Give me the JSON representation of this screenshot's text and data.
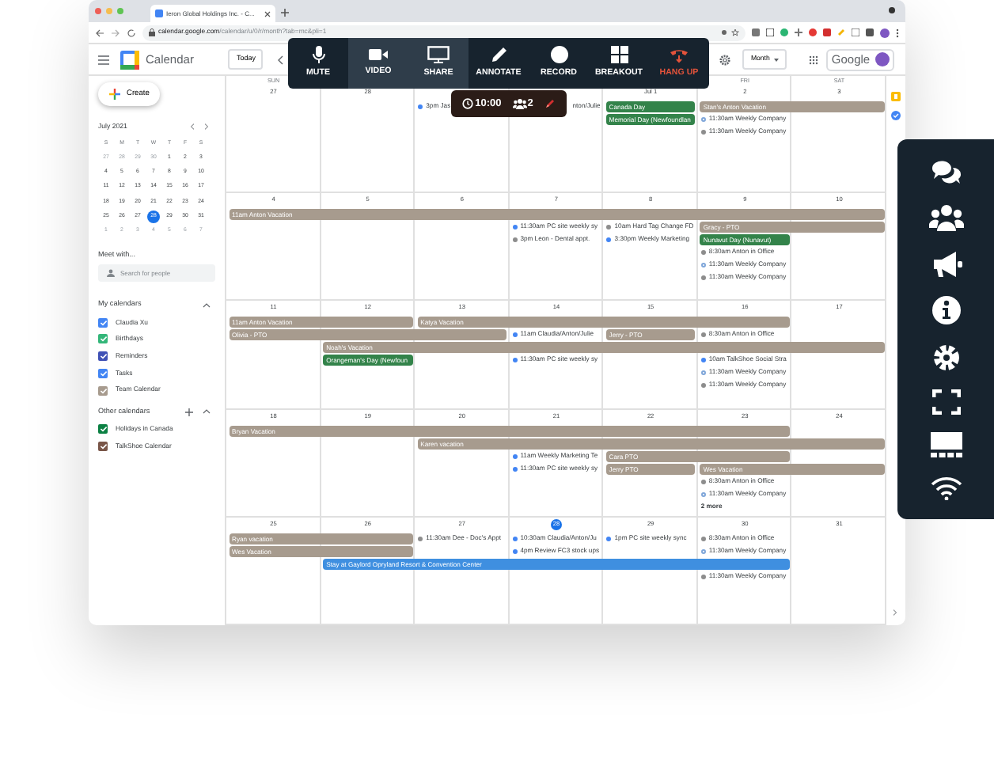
{
  "browser": {
    "tab_title": "Ieron Global Holdings Inc. - C...",
    "url_host": "calendar.google.com",
    "url_path": "/calendar/u/0/r/month?tab=mc&pli=1"
  },
  "app_header": {
    "title": "Calendar",
    "today": "Today",
    "view": "Month",
    "brand": "Google"
  },
  "call_toolbar": {
    "buttons": [
      {
        "label": "MUTE",
        "selected": false,
        "kind": "normal"
      },
      {
        "label": "VIDEO",
        "selected": true,
        "kind": "normal"
      },
      {
        "label": "SHARE",
        "selected": true,
        "kind": "normal"
      },
      {
        "label": "ANNOTATE",
        "selected": false,
        "kind": "normal"
      },
      {
        "label": "RECORD",
        "selected": false,
        "kind": "normal"
      },
      {
        "label": "BREAKOUT",
        "selected": false,
        "kind": "normal"
      },
      {
        "label": "HANG UP",
        "selected": false,
        "kind": "danger"
      }
    ],
    "timer": "10:00",
    "participants": "2"
  },
  "sidebar": {
    "create": "Create",
    "mini_calendar": {
      "month": "July 2021",
      "weekdays": [
        "S",
        "M",
        "T",
        "W",
        "T",
        "F",
        "S"
      ],
      "weeks": [
        [
          {
            "label": "27",
            "outside": true,
            "selected": false
          },
          {
            "label": "28",
            "outside": true,
            "selected": false
          },
          {
            "label": "29",
            "outside": true,
            "selected": false
          },
          {
            "label": "30",
            "outside": true,
            "selected": false
          },
          {
            "label": "1",
            "outside": false,
            "selected": false
          },
          {
            "label": "2",
            "outside": false,
            "selected": false
          },
          {
            "label": "3",
            "outside": false,
            "selected": false
          }
        ],
        [
          {
            "label": "4",
            "outside": false,
            "selected": false
          },
          {
            "label": "5",
            "outside": false,
            "selected": false
          },
          {
            "label": "6",
            "outside": false,
            "selected": false
          },
          {
            "label": "7",
            "outside": false,
            "selected": false
          },
          {
            "label": "8",
            "outside": false,
            "selected": false
          },
          {
            "label": "9",
            "outside": false,
            "selected": false
          },
          {
            "label": "10",
            "outside": false,
            "selected": false
          }
        ],
        [
          {
            "label": "11",
            "outside": false,
            "selected": false
          },
          {
            "label": "12",
            "outside": false,
            "selected": false
          },
          {
            "label": "13",
            "outside": false,
            "selected": false
          },
          {
            "label": "14",
            "outside": false,
            "selected": false
          },
          {
            "label": "15",
            "outside": false,
            "selected": false
          },
          {
            "label": "16",
            "outside": false,
            "selected": false
          },
          {
            "label": "17",
            "outside": false,
            "selected": false
          }
        ],
        [
          {
            "label": "18",
            "outside": false,
            "selected": false
          },
          {
            "label": "19",
            "outside": false,
            "selected": false
          },
          {
            "label": "20",
            "outside": false,
            "selected": false
          },
          {
            "label": "21",
            "outside": false,
            "selected": false
          },
          {
            "label": "22",
            "outside": false,
            "selected": false
          },
          {
            "label": "23",
            "outside": false,
            "selected": false
          },
          {
            "label": "24",
            "outside": false,
            "selected": false
          }
        ],
        [
          {
            "label": "25",
            "outside": false,
            "selected": false
          },
          {
            "label": "26",
            "outside": false,
            "selected": false
          },
          {
            "label": "27",
            "outside": false,
            "selected": false
          },
          {
            "label": "28",
            "outside": false,
            "selected": true
          },
          {
            "label": "29",
            "outside": false,
            "selected": false
          },
          {
            "label": "30",
            "outside": false,
            "selected": false
          },
          {
            "label": "31",
            "outside": false,
            "selected": false
          }
        ],
        [
          {
            "label": "1",
            "outside": true,
            "selected": false
          },
          {
            "label": "2",
            "outside": true,
            "selected": false
          },
          {
            "label": "3",
            "outside": true,
            "selected": false
          },
          {
            "label": "4",
            "outside": true,
            "selected": false
          },
          {
            "label": "5",
            "outside": true,
            "selected": false
          },
          {
            "label": "6",
            "outside": true,
            "selected": false
          },
          {
            "label": "7",
            "outside": true,
            "selected": false
          }
        ]
      ]
    },
    "meet_with": "Meet with...",
    "search": {
      "placeholder": "Search for people"
    },
    "my_calendars": {
      "title": "My calendars",
      "expanded": true,
      "items": [
        {
          "label": "Claudia Xu",
          "color": "#4285f4",
          "checked": true
        },
        {
          "label": "Birthdays",
          "color": "#33b679",
          "checked": true
        },
        {
          "label": "Reminders",
          "color": "#3f51b5",
          "checked": true
        },
        {
          "label": "Tasks",
          "color": "#4285f4",
          "checked": true
        },
        {
          "label": "Team Calendar",
          "color": "#a79b8e",
          "checked": true
        }
      ]
    },
    "other_calendars": {
      "title": "Other calendars",
      "expanded": true,
      "items": [
        {
          "label": "Holidays in Canada",
          "color": "#0b8043",
          "checked": true
        },
        {
          "label": "TalkShoe Calendar",
          "color": "#795548",
          "checked": true
        }
      ]
    }
  },
  "month_grid": {
    "weeks": [
      {
        "days": [
          {
            "weekday": "SUN",
            "date": "27",
            "today": false
          },
          {
            "date": "28",
            "today": false
          },
          {
            "date": "Jul 1",
            "today": false
          },
          {
            "weekday": "FRI",
            "date": "2",
            "today": false
          },
          {
            "weekday": "SAT",
            "date": "3",
            "today": false
          }
        ],
        "events": [
          {
            "kind": "timed",
            "text": "3pm Jas",
            "color": "#4285f4"
          },
          {
            "kind": "partial",
            "text": "nton/Julie"
          },
          {
            "kind": "bar",
            "text": "Canada Day",
            "color": "#33834a"
          },
          {
            "kind": "bar",
            "text": "Stan's Anton Vacation",
            "color": "#a79b8e"
          },
          {
            "kind": "bar",
            "text": "Memorial Day (Newfoundlan",
            "color": "#33834a"
          },
          {
            "kind": "tentative",
            "text": "11:30am Weekly Company",
            "color": "#7fa6d9"
          },
          {
            "kind": "timed",
            "text": "11:30am Weekly Company",
            "color": "#8d8d8d"
          }
        ]
      },
      {
        "days": [
          {
            "date": "4",
            "today": false
          },
          {
            "date": "5",
            "today": false
          },
          {
            "date": "6",
            "today": false
          },
          {
            "date": "7",
            "today": false
          },
          {
            "date": "8",
            "today": false
          },
          {
            "date": "9",
            "today": false
          },
          {
            "date": "10",
            "today": false
          }
        ],
        "events": [
          {
            "kind": "bar",
            "text": "11am Anton Vacation",
            "color": "#a79b8e"
          },
          {
            "kind": "timed",
            "text": "11:30am PC site weekly sy",
            "color": "#4285f4"
          },
          {
            "kind": "timed",
            "text": "10am Hard Tag Change FD",
            "color": "#8d8d8d"
          },
          {
            "kind": "bar",
            "text": "Gracy - PTO",
            "color": "#a79b8e"
          },
          {
            "kind": "timed",
            "text": "3pm Leon - Dental appt.",
            "color": "#8d8d8d"
          },
          {
            "kind": "timed",
            "text": "3:30pm Weekly Marketing",
            "color": "#4285f4"
          },
          {
            "kind": "bar",
            "text": "Nunavut Day (Nunavut)",
            "color": "#33834a"
          },
          {
            "kind": "timed",
            "text": "8:30am Anton in Office",
            "color": "#8d8d8d"
          },
          {
            "kind": "tentative",
            "text": "11:30am Weekly Company",
            "color": "#7fa6d9"
          },
          {
            "kind": "timed",
            "text": "11:30am Weekly Company",
            "color": "#8d8d8d"
          }
        ]
      },
      {
        "days": [
          {
            "date": "11",
            "today": false
          },
          {
            "date": "12",
            "today": false
          },
          {
            "date": "13",
            "today": false
          },
          {
            "date": "14",
            "today": false
          },
          {
            "date": "15",
            "today": false
          },
          {
            "date": "16",
            "today": false
          },
          {
            "date": "17",
            "today": false
          }
        ],
        "events": [
          {
            "kind": "bar",
            "text": "11am Anton Vacation",
            "color": "#a79b8e"
          },
          {
            "kind": "bar",
            "text": "Katya Vacation",
            "color": "#a79b8e"
          },
          {
            "kind": "bar",
            "text": "Olivia - PTO",
            "color": "#a79b8e"
          },
          {
            "kind": "timed",
            "text": "11am Claudia/Anton/Julie",
            "color": "#4285f4"
          },
          {
            "kind": "bar",
            "text": "Jerry - PTO",
            "color": "#a79b8e"
          },
          {
            "kind": "timed",
            "text": "8:30am Anton in Office",
            "color": "#8d8d8d"
          },
          {
            "kind": "bar",
            "text": "Noah's Vacation",
            "color": "#a79b8e"
          },
          {
            "kind": "bar",
            "text": "Orangeman's Day (Newfoun",
            "color": "#33834a"
          },
          {
            "kind": "timed",
            "text": "11:30am PC site weekly sy",
            "color": "#4285f4"
          },
          {
            "kind": "timed",
            "text": "10am TalkShoe Social Stra",
            "color": "#4285f4"
          },
          {
            "kind": "tentative",
            "text": "11:30am Weekly Company",
            "color": "#7fa6d9"
          },
          {
            "kind": "timed",
            "text": "11:30am Weekly Company",
            "color": "#8d8d8d"
          }
        ]
      },
      {
        "days": [
          {
            "date": "18",
            "today": false
          },
          {
            "date": "19",
            "today": false
          },
          {
            "date": "20",
            "today": false
          },
          {
            "date": "21",
            "today": false
          },
          {
            "date": "22",
            "today": false
          },
          {
            "date": "23",
            "today": false
          },
          {
            "date": "24",
            "today": false
          }
        ],
        "events": [
          {
            "kind": "bar",
            "text": "Bryan Vacation",
            "color": "#a79b8e"
          },
          {
            "kind": "bar",
            "text": "Karen vacation",
            "color": "#a79b8e"
          },
          {
            "kind": "timed",
            "text": "11am Weekly Marketing Te",
            "color": "#4285f4"
          },
          {
            "kind": "bar",
            "text": "Cara PTO",
            "color": "#a79b8e"
          },
          {
            "kind": "timed",
            "text": "11:30am PC site weekly sy",
            "color": "#4285f4"
          },
          {
            "kind": "bar",
            "text": "Jerry PTO",
            "color": "#a79b8e"
          },
          {
            "kind": "bar",
            "text": "Wes Vacation",
            "color": "#a79b8e"
          },
          {
            "kind": "timed",
            "text": "8:30am Anton in Office",
            "color": "#8d8d8d"
          },
          {
            "kind": "tentative",
            "text": "11:30am Weekly Company",
            "color": "#7fa6d9"
          },
          {
            "kind": "more",
            "text": "2 more"
          }
        ]
      },
      {
        "days": [
          {
            "date": "25",
            "today": false
          },
          {
            "date": "26",
            "today": false
          },
          {
            "date": "27",
            "today": false
          },
          {
            "date": "28",
            "today": true
          },
          {
            "date": "29",
            "today": false
          },
          {
            "date": "30",
            "today": false
          },
          {
            "date": "31",
            "today": false
          }
        ],
        "events": [
          {
            "kind": "bar",
            "text": "Ryan vacation",
            "color": "#a79b8e"
          },
          {
            "kind": "timed",
            "text": "11:30am Dee - Doc's Appt",
            "color": "#8d8d8d"
          },
          {
            "kind": "timed",
            "text": "10:30am Claudia/Anton/Ju",
            "color": "#4285f4"
          },
          {
            "kind": "timed",
            "text": "1pm PC site weekly sync",
            "color": "#4285f4"
          },
          {
            "kind": "timed",
            "text": "8:30am Anton in Office",
            "color": "#8d8d8d"
          },
          {
            "kind": "bar",
            "text": "Wes Vacation",
            "color": "#a79b8e"
          },
          {
            "kind": "timed",
            "text": "4pm Review FC3 stock ups",
            "color": "#4285f4"
          },
          {
            "kind": "tentative",
            "text": "11:30am Weekly Company",
            "color": "#7fa6d9"
          },
          {
            "kind": "bar",
            "text": "Stay at Gaylord Opryland Resort & Convention Center",
            "color": "#3f8fe0"
          },
          {
            "kind": "timed",
            "text": "11:30am Weekly Company",
            "color": "#8d8d8d"
          }
        ]
      }
    ]
  }
}
